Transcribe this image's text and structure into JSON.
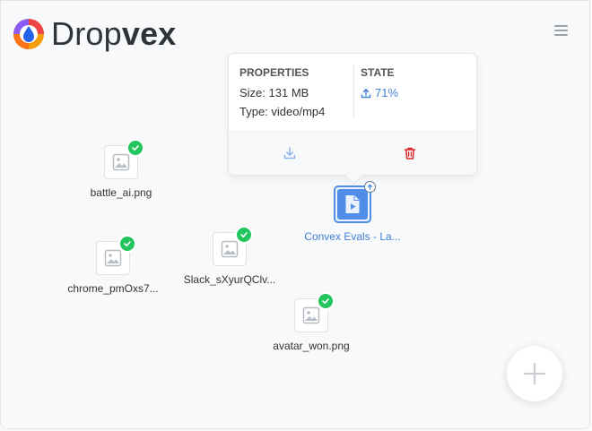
{
  "app": {
    "brand_part1": "Drop",
    "brand_part2": "vex",
    "menu_icon": "hamburger-icon"
  },
  "colors": {
    "accent": "#3f7fd8",
    "success": "#22c55e",
    "danger": "#dc2626"
  },
  "files": [
    {
      "name": "battle_ai.png",
      "status": "uploaded",
      "icon": "image-icon"
    },
    {
      "name": "chrome_pmOxs7...",
      "status": "uploaded",
      "icon": "image-icon"
    },
    {
      "name": "Slack_sXyurQClv...",
      "status": "uploaded",
      "icon": "image-icon"
    },
    {
      "name": "avatar_won.png",
      "status": "uploaded",
      "icon": "image-icon"
    },
    {
      "name": "Convex Evals - La...",
      "status": "uploading",
      "icon": "video-file-icon"
    }
  ],
  "popover": {
    "properties_heading": "PROPERTIES",
    "size_text": "Size: 131 MB",
    "type_text": "Type: video/mp4",
    "state_heading": "STATE",
    "state_value": "71%",
    "download_icon": "download-icon",
    "delete_icon": "trash-icon"
  },
  "fab": {
    "icon": "plus-icon"
  }
}
